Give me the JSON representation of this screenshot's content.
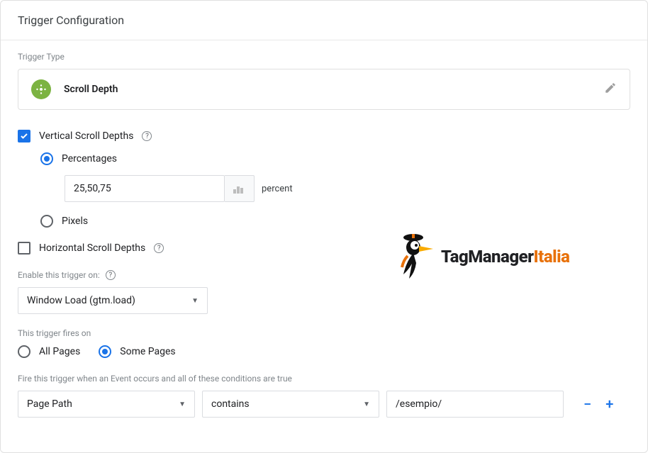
{
  "header": {
    "title": "Trigger Configuration"
  },
  "triggerType": {
    "label": "Trigger Type",
    "name": "Scroll Depth"
  },
  "vertical": {
    "label": "Vertical Scroll Depths",
    "checked": true,
    "mode": "percentages",
    "percentages": {
      "label": "Percentages",
      "value": "25,50,75",
      "unit": "percent"
    },
    "pixels": {
      "label": "Pixels"
    }
  },
  "horizontal": {
    "label": "Horizontal Scroll Depths",
    "checked": false
  },
  "enableOn": {
    "label": "Enable this trigger on:",
    "value": "Window Load (gtm.load)"
  },
  "firesOn": {
    "label": "This trigger fires on",
    "all": "All Pages",
    "some": "Some Pages",
    "selected": "some"
  },
  "conditions": {
    "label": "Fire this trigger when an Event occurs and all of these conditions are true",
    "rows": [
      {
        "variable": "Page Path",
        "operator": "contains",
        "value": "/esempio/"
      }
    ]
  },
  "logo": {
    "brand": "TagManager",
    "suffix": "Italia"
  }
}
